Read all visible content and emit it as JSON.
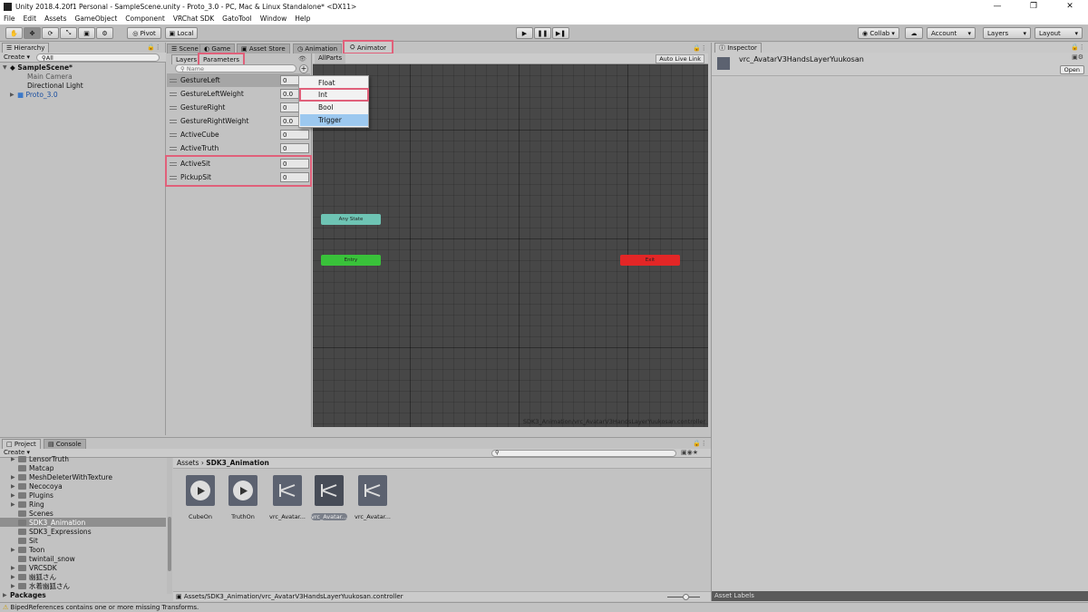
{
  "window": {
    "title": "Unity 2018.4.20f1 Personal - SampleScene.unity - Proto_3.0 - PC, Mac & Linux Standalone* <DX11>"
  },
  "menu": [
    "File",
    "Edit",
    "Assets",
    "GameObject",
    "Component",
    "VRChat SDK",
    "GatoTool",
    "Window",
    "Help"
  ],
  "toolbar": {
    "pivot": "Pivot",
    "local": "Local",
    "collab": "Collab",
    "account": "Account",
    "layers": "Layers",
    "layout": "Layout"
  },
  "hierarchy": {
    "tab": "Hierarchy",
    "create": "Create",
    "search": "All",
    "scene": "SampleScene*",
    "items": [
      "Main Camera",
      "Directional Light",
      "Proto_3.0"
    ]
  },
  "center_tabs": [
    "Scene",
    "Game",
    "Asset Store",
    "Animation",
    "Animator"
  ],
  "animator": {
    "layers_tab": "Layers",
    "params_tab": "Parameters",
    "search_placeholder": "Name",
    "breadcrumb": "AllParts",
    "live_link": "Auto Live Link",
    "path": "SDK3_Animation/vrc_AvatarV3HandsLayerYuukosan.controller",
    "params": [
      {
        "name": "GestureLeft",
        "value": "0"
      },
      {
        "name": "GestureLeftWeight",
        "value": "0.0"
      },
      {
        "name": "GestureRight",
        "value": "0"
      },
      {
        "name": "GestureRightWeight",
        "value": "0.0"
      },
      {
        "name": "ActiveCube",
        "value": "0"
      },
      {
        "name": "ActiveTruth",
        "value": "0"
      },
      {
        "name": "ActiveSit",
        "value": "0"
      },
      {
        "name": "PickupSit",
        "value": "0"
      }
    ],
    "nodes": {
      "any": "Any State",
      "entry": "Entry",
      "exit": "Exit"
    },
    "dropdown": [
      "Float",
      "Int",
      "Bool",
      "Trigger"
    ]
  },
  "inspector": {
    "tab": "Inspector",
    "name": "vrc_AvatarV3HandsLayerYuukosan",
    "open": "Open",
    "asset_labels": "Asset Labels"
  },
  "project": {
    "tab": "Project",
    "console": "Console",
    "create": "Create",
    "breadcrumb_root": "Assets",
    "breadcrumb_leaf": "SDK3_Animation",
    "folders": [
      "LensorTruth",
      "Matcap",
      "MeshDeleterWithTexture",
      "Necocoya",
      "Plugins",
      "Ring",
      "Scenes",
      "SDK3_Animation",
      "SDK3_Expressions",
      "Sit",
      "Toon",
      "twintail_snow",
      "VRCSDK",
      "幽狐さん",
      "水着幽狐さん"
    ],
    "packages": "Packages",
    "assets": [
      "CubeOn",
      "TruthOn",
      "vrc_Avatar...",
      "vrc_Avatar...",
      "vrc_Avatar..."
    ],
    "path": "Assets/SDK3_Animation/vrc_AvatarV3HandsLayerYuukosan.controller"
  },
  "status": "BipedReferences contains one or more missing Transforms."
}
